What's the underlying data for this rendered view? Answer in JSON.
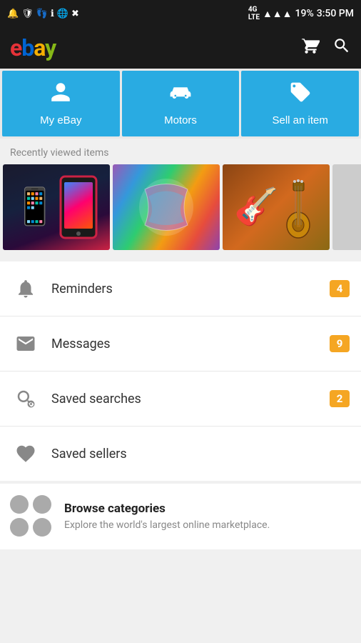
{
  "statusBar": {
    "time": "3:50 PM",
    "battery": "19%",
    "signal": "4G LTE"
  },
  "header": {
    "logo": [
      "e",
      "b",
      "a",
      "y"
    ],
    "cartIcon": "🛒",
    "searchIcon": "🔍"
  },
  "navButtons": [
    {
      "id": "my-ebay",
      "label": "My eBay",
      "icon": "person"
    },
    {
      "id": "motors",
      "label": "Motors",
      "icon": "car"
    },
    {
      "id": "sell",
      "label": "Sell an item",
      "icon": "tag"
    }
  ],
  "recentlyViewed": {
    "label": "Recently viewed items",
    "items": [
      {
        "id": "phone",
        "type": "phone"
      },
      {
        "id": "scarf",
        "type": "scarf"
      },
      {
        "id": "guitar",
        "type": "guitar"
      },
      {
        "id": "extra",
        "type": "extra"
      }
    ]
  },
  "menuItems": [
    {
      "id": "reminders",
      "label": "Reminders",
      "badge": "4",
      "iconType": "bell"
    },
    {
      "id": "messages",
      "label": "Messages",
      "badge": "9",
      "iconType": "envelope"
    },
    {
      "id": "saved-searches",
      "label": "Saved searches",
      "badge": "2",
      "iconType": "search-gear"
    },
    {
      "id": "saved-sellers",
      "label": "Saved sellers",
      "badge": null,
      "iconType": "heart"
    }
  ],
  "browseCategories": {
    "title": "Browse categories",
    "description": "Explore the world's largest online marketplace."
  }
}
